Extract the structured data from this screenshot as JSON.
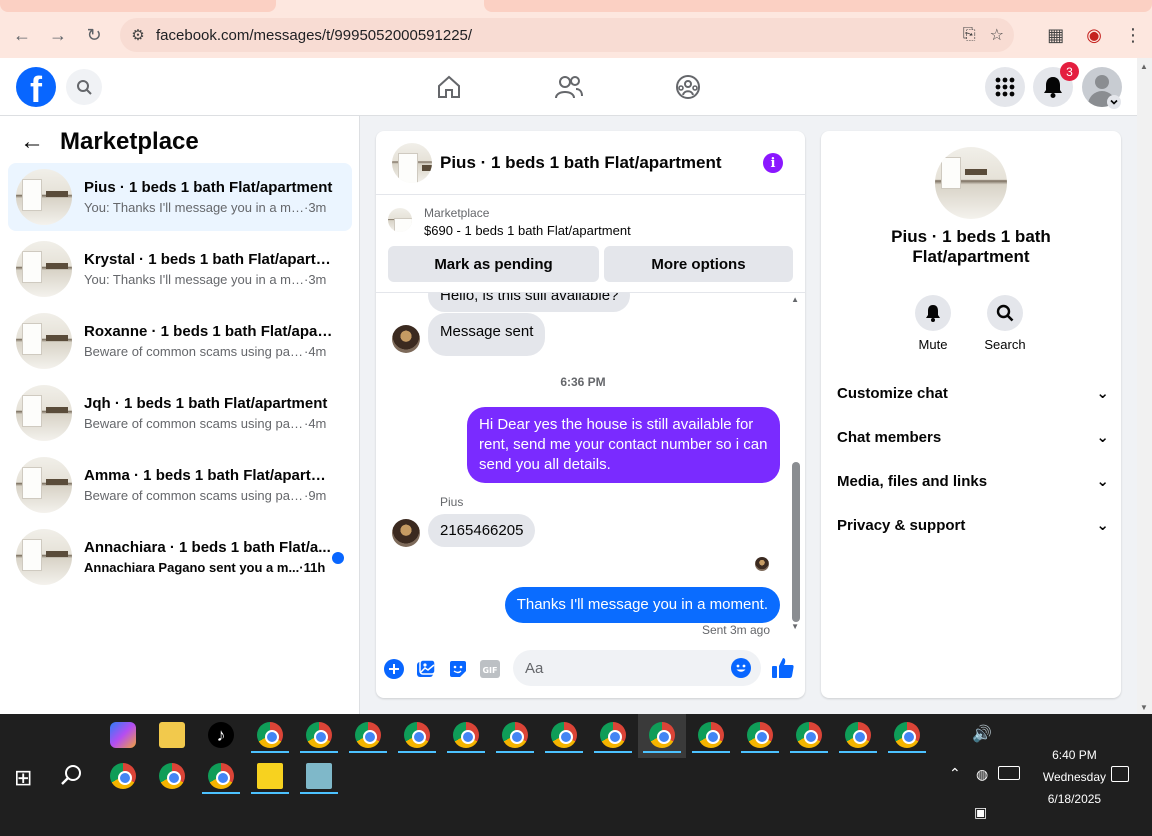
{
  "browser": {
    "url": "facebook.com/messages/t/9995052000591225/"
  },
  "fb_nav": {
    "logo": "f",
    "notification_count": "3",
    "icons": [
      "home-icon",
      "friends-icon",
      "groups-icon",
      "menu-grid-icon",
      "bell-icon"
    ]
  },
  "sidebar": {
    "title": "Marketplace",
    "conversations": [
      {
        "name": "Pius · 1 beds 1 bath Flat/apartment",
        "preview": "You: Thanks I'll message you in a mo...",
        "time": "·3m",
        "active": true
      },
      {
        "name": "Krystal · 1 beds 1 bath Flat/apartm...",
        "preview": "You: Thanks I'll message you in a mo...",
        "time": "·3m"
      },
      {
        "name": "Roxanne · 1 beds 1 bath Flat/apart...",
        "preview": "Beware of common scams using pay...",
        "time": "·4m"
      },
      {
        "name": "Jqh · 1 beds 1 bath Flat/apartment",
        "preview": "Beware of common scams using pay...",
        "time": "·4m"
      },
      {
        "name": "Amma · 1 beds 1 bath Flat/apartm...",
        "preview": "Beware of common scams using pay...",
        "time": "·9m"
      },
      {
        "name": "Annachiara · 1 beds 1 bath Flat/a...",
        "preview": "Annachiara Pagano sent you a m...",
        "time": "·11h",
        "unread": true
      }
    ]
  },
  "chat": {
    "title": "Pius · 1 beds 1 bath Flat/apartment",
    "listing": {
      "label": "Marketplace",
      "title": "$690 - 1 beds 1 bath Flat/apartment"
    },
    "buttons": {
      "pending": "Mark as pending",
      "options": "More options"
    },
    "messages": {
      "cut_off": "Hello, is this still available?",
      "sent_notice": "Message sent",
      "timestamp": "6:36 PM",
      "outgoing_1": "Hi Dear yes the house is still available for rent, send me your contact number so i can send you all details.",
      "sender_name": "Pius",
      "incoming_number": "2165466205",
      "outgoing_2": "Thanks I'll message you in a moment.",
      "status": "Sent 3m ago"
    },
    "composer_placeholder": "Aa"
  },
  "info_panel": {
    "name": "Pius · 1 beds 1 bath Flat/apartment",
    "actions": {
      "mute": "Mute",
      "search": "Search"
    },
    "sections": [
      "Customize chat",
      "Chat members",
      "Media, files and links",
      "Privacy & support"
    ]
  },
  "taskbar": {
    "time": "6:40 PM",
    "day": "Wednesday",
    "date": "6/18/2025"
  },
  "colors": {
    "fb_blue": "#0866ff",
    "purple_bubble": "#7a2bff",
    "blue_bubble": "#0a6cff",
    "taskbar": "#1f1f1f"
  }
}
